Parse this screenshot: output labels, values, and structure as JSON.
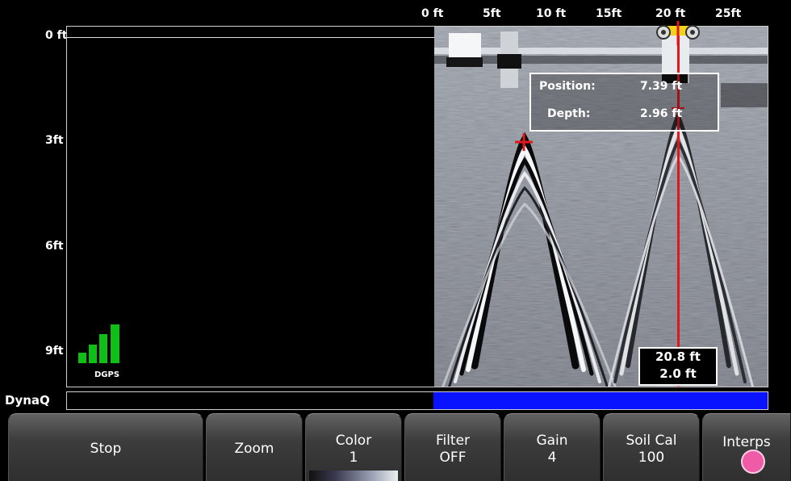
{
  "horizontal_scale": {
    "labels": [
      "0 ft",
      "5ft",
      "10 ft",
      "15ft",
      "20 ft",
      "25ft"
    ]
  },
  "depth_scale": {
    "labels": [
      "0 ft",
      "3ft",
      "6ft",
      "9ft"
    ]
  },
  "gps": {
    "label": "DGPS",
    "signal_bars": 4,
    "color": "#0fbf16"
  },
  "info_box": {
    "position_label": "Position:",
    "position_value": "7.39 ft",
    "depth_label": "Depth:",
    "depth_value": "2.96 ft"
  },
  "cursor_readout": {
    "distance": "20.8 ft",
    "depth": "2.0 ft"
  },
  "dynaq": {
    "label": "DynaQ",
    "fill_fraction": 0.477,
    "fill_color": "#0a13ff"
  },
  "cursor_color": "#e0181e",
  "softkeys": {
    "stop": {
      "label": "Stop"
    },
    "zoom": {
      "label": "Zoom"
    },
    "color": {
      "label": "Color",
      "value": "1"
    },
    "filter": {
      "label": "Filter",
      "value": "OFF"
    },
    "gain": {
      "label": "Gain",
      "value": "4"
    },
    "soil_cal": {
      "label": "Soil Cal",
      "value": "100"
    },
    "interps": {
      "label": "Interps",
      "indicator_color": "#f05ba8"
    }
  }
}
